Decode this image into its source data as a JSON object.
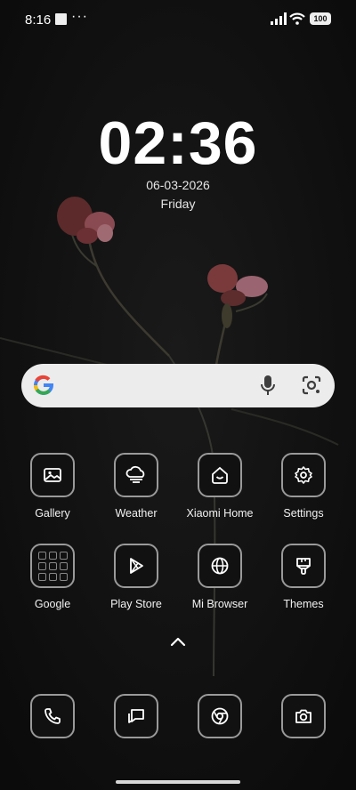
{
  "status_bar": {
    "time": "8:16",
    "more": "···",
    "battery": "100"
  },
  "lock": {
    "clock": "02:36",
    "date": "06-03-2026",
    "day": "Friday"
  },
  "search": {
    "google_icon": "google-g-icon",
    "mic_icon": "mic-icon",
    "lens_icon": "google-lens-icon"
  },
  "apps": [
    {
      "label": "Gallery",
      "icon": "gallery-icon"
    },
    {
      "label": "Weather",
      "icon": "weather-cloud-icon"
    },
    {
      "label": "Xiaomi Home",
      "icon": "xiaomi-home-icon"
    },
    {
      "label": "Settings",
      "icon": "gear-icon"
    },
    {
      "label": "Google",
      "icon": "folder-icon"
    },
    {
      "label": "Play Store",
      "icon": "play-store-icon"
    },
    {
      "label": "Mi Browser",
      "icon": "globe-icon"
    },
    {
      "label": "Themes",
      "icon": "paint-brush-icon"
    }
  ],
  "dock": [
    {
      "icon": "phone-icon"
    },
    {
      "icon": "messages-icon"
    },
    {
      "icon": "chrome-icon"
    },
    {
      "icon": "camera-icon"
    }
  ],
  "colors": {
    "background": "#101010",
    "search_bg": "#ececec",
    "icon_border": "#9a9a9a"
  }
}
